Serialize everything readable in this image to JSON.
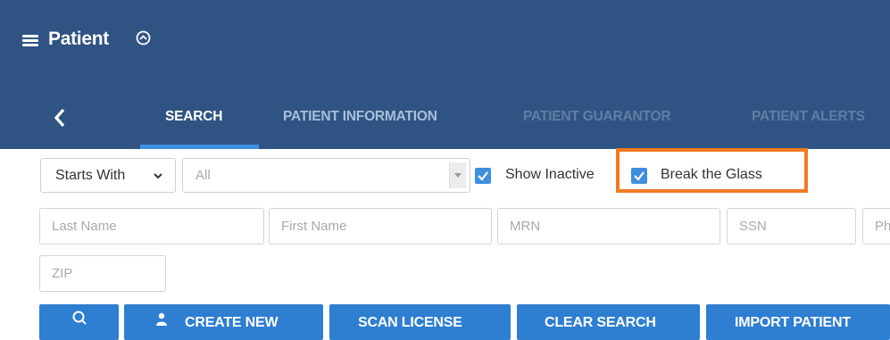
{
  "header": {
    "title": "Patient",
    "menu_icon": "hamburger-menu-icon",
    "title_icon": "chevron-circle-icon"
  },
  "tabs": [
    {
      "label": "SEARCH",
      "active": true
    },
    {
      "label": "PATIENT INFORMATION",
      "active": false
    },
    {
      "label": "PATIENT GUARANTOR",
      "active": false,
      "disabled": true
    },
    {
      "label": "PATIENT ALERTS",
      "active": false,
      "disabled": true
    }
  ],
  "filters": {
    "match_mode": "Starts With",
    "scope": "All",
    "show_inactive_label": "Show Inactive",
    "show_inactive_checked": true,
    "break_glass_label": "Break the Glass",
    "break_glass_checked": true
  },
  "fields": {
    "last_name": "Last Name",
    "first_name": "First Name",
    "mrn": "MRN",
    "ssn": "SSN",
    "phone": "Ph",
    "zip": "ZIP"
  },
  "buttons": {
    "create_new": "CREATE NEW",
    "scan_license": "SCAN LICENSE",
    "clear_search": "CLEAR SEARCH",
    "import_patient": "IMPORT PATIENT"
  },
  "colors": {
    "header": "#2f5483",
    "accent": "#3f8fe0",
    "button": "#2e7ed1",
    "highlight": "#f07a23"
  }
}
